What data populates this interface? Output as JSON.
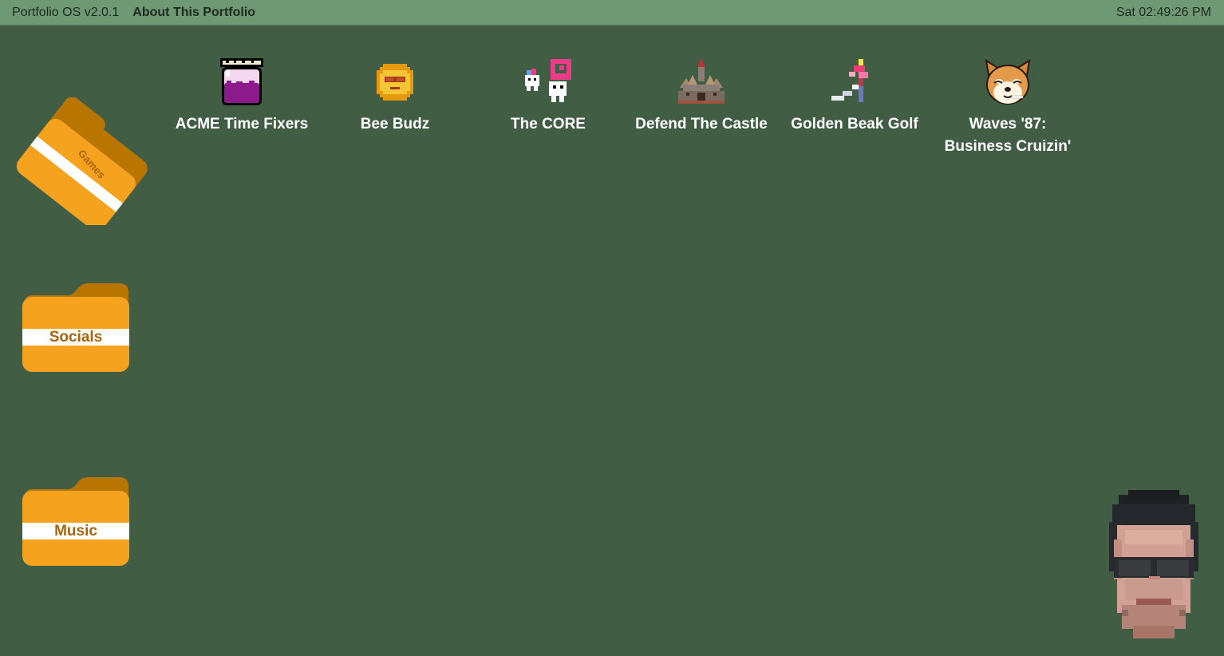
{
  "menubar": {
    "os_name": "Portfolio OS v2.0.1",
    "about": "About This Portfolio",
    "clock": "Sat 02:49:26 PM"
  },
  "folders": [
    {
      "label": "Games",
      "icon": "folder-open-icon",
      "color": "#f5a21e"
    },
    {
      "label": "Socials",
      "icon": "folder-icon",
      "color": "#f5a21e"
    },
    {
      "label": "Music",
      "icon": "folder-icon",
      "color": "#f5a21e"
    }
  ],
  "apps": [
    {
      "name": "ACME Time Fixers",
      "icon": "jar-icon"
    },
    {
      "name": "Bee Budz",
      "icon": "sun-face-icon"
    },
    {
      "name": "The CORE",
      "icon": "pixel-characters-icon"
    },
    {
      "name": "Defend The Castle",
      "icon": "castle-icon"
    },
    {
      "name": "Golden Beak Golf",
      "icon": "golf-flag-icon"
    },
    {
      "name": "Waves '87: Business Cruizin'",
      "icon": "shiba-dog-icon"
    }
  ],
  "avatar": {
    "icon": "pixelated-face-avatar"
  },
  "colors": {
    "desktop": "#415e45",
    "menubar": "#6f9875",
    "folder": "#f5a21e",
    "folder_back": "#b87500",
    "folder_label": "#a8650c"
  }
}
